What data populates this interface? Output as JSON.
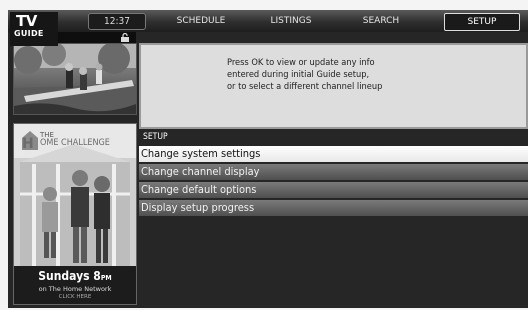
{
  "logo": {
    "line1": "TV",
    "line2": "GUIDE"
  },
  "clock": "12:37",
  "nav": {
    "tabs": [
      {
        "label": "SCHEDULE",
        "selected": false
      },
      {
        "label": "LISTINGS",
        "selected": false
      },
      {
        "label": "SEARCH",
        "selected": false
      },
      {
        "label": "SETUP",
        "selected": true
      }
    ]
  },
  "lock_icon": "padlock-icon",
  "info": {
    "lines": [
      "Press OK to view or update any info",
      "entered during initial Guide setup,",
      "or to select a different channel lineup"
    ]
  },
  "menu": {
    "title": "SETUP",
    "items": [
      {
        "label": "Change system settings",
        "selected": true
      },
      {
        "label": "Change channel display",
        "selected": false
      },
      {
        "label": "Change default options",
        "selected": false
      },
      {
        "label": "Display setup progress",
        "selected": false
      }
    ]
  },
  "ad": {
    "brand_small": "THE",
    "brand_letter": "H",
    "brand_rest": "OME CHALLENGE",
    "day": "Sundays 8",
    "day_suffix": "PM",
    "network": "on The Home Network",
    "cta": "CLICK HERE"
  },
  "colors": {
    "accent": "#ffffff",
    "frame": "#262626",
    "panel": "#dddddd"
  }
}
